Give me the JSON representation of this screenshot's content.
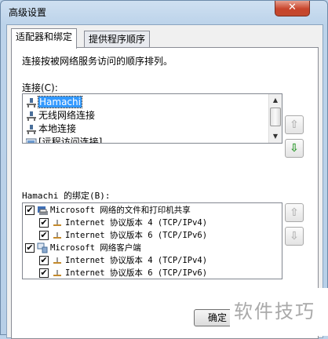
{
  "window": {
    "title": "高级设置",
    "close_glyph": "✕"
  },
  "tabs": [
    {
      "label": "适配器和绑定",
      "active": true
    },
    {
      "label": "提供程序顺序",
      "active": false
    }
  ],
  "description": "连接按被网络服务访问的顺序排列。",
  "connections": {
    "label": "连接(C):",
    "items": [
      {
        "label": "Hamachi",
        "icon": "network-adapter-icon",
        "selected": true
      },
      {
        "label": "无线网络连接",
        "icon": "network-adapter-icon",
        "selected": false
      },
      {
        "label": "本地连接",
        "icon": "network-adapter-icon",
        "selected": false
      },
      {
        "label": "[远程访问连接]",
        "icon": "remote-access-icon",
        "selected": false
      }
    ],
    "up_button": {
      "glyph": "⇧",
      "enabled": false
    },
    "down_button": {
      "glyph": "⇩",
      "enabled": true
    }
  },
  "bindings": {
    "label": "Hamachi 的绑定(B):",
    "items": [
      {
        "label": "Microsoft 网络的文件和打印机共享",
        "level": 0,
        "checked": true,
        "icon": "file-printer-sharing-icon"
      },
      {
        "label": "Internet 协议版本 4 (TCP/IPv4)",
        "level": 1,
        "checked": true,
        "icon": "protocol-icon"
      },
      {
        "label": "Internet 协议版本 6 (TCP/IPv6)",
        "level": 1,
        "checked": true,
        "icon": "protocol-icon"
      },
      {
        "label": "Microsoft 网络客户端",
        "level": 0,
        "checked": true,
        "icon": "network-client-icon"
      },
      {
        "label": "Internet 协议版本 4 (TCP/IPv4)",
        "level": 1,
        "checked": true,
        "icon": "protocol-icon"
      },
      {
        "label": "Internet 协议版本 6 (TCP/IPv6)",
        "level": 1,
        "checked": true,
        "icon": "protocol-icon"
      }
    ],
    "up_button": {
      "glyph": "⇧",
      "enabled": false
    },
    "down_button": {
      "glyph": "⇩",
      "enabled": false
    }
  },
  "ok_button": "确定",
  "watermark": "软件技巧",
  "colors": {
    "selection": "#3399ff",
    "arrow_enabled": "#2f9a2f",
    "close_button": "#c8442b"
  }
}
